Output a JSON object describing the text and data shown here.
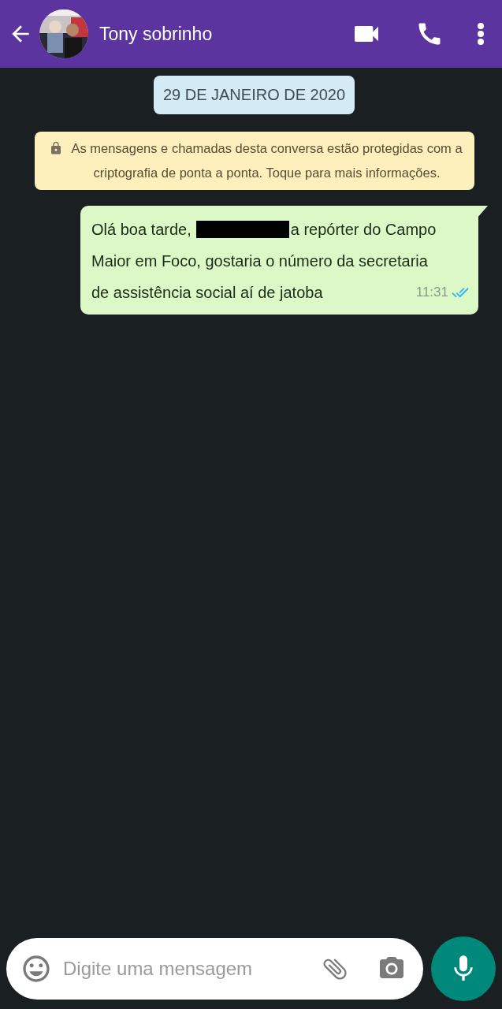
{
  "header": {
    "contact_name": "Tony sobrinho"
  },
  "date_chip": "29 DE JANEIRO DE 2020",
  "encryption_notice": "As mensagens e chamadas desta conversa estão protegidas com a criptografia de ponta a ponta. Toque para mais informações.",
  "messages": [
    {
      "kind": "outgoing",
      "text_before": "Olá boa tarde,",
      "redacted": true,
      "text_after": "a repórter do Campo",
      "lines": [
        "Maior em Foco, gostaria o número da secretaria",
        "de assistência social aí de jatoba"
      ],
      "time": "11:31",
      "read": true
    }
  ],
  "composer": {
    "placeholder": "Digite uma mensagem"
  }
}
